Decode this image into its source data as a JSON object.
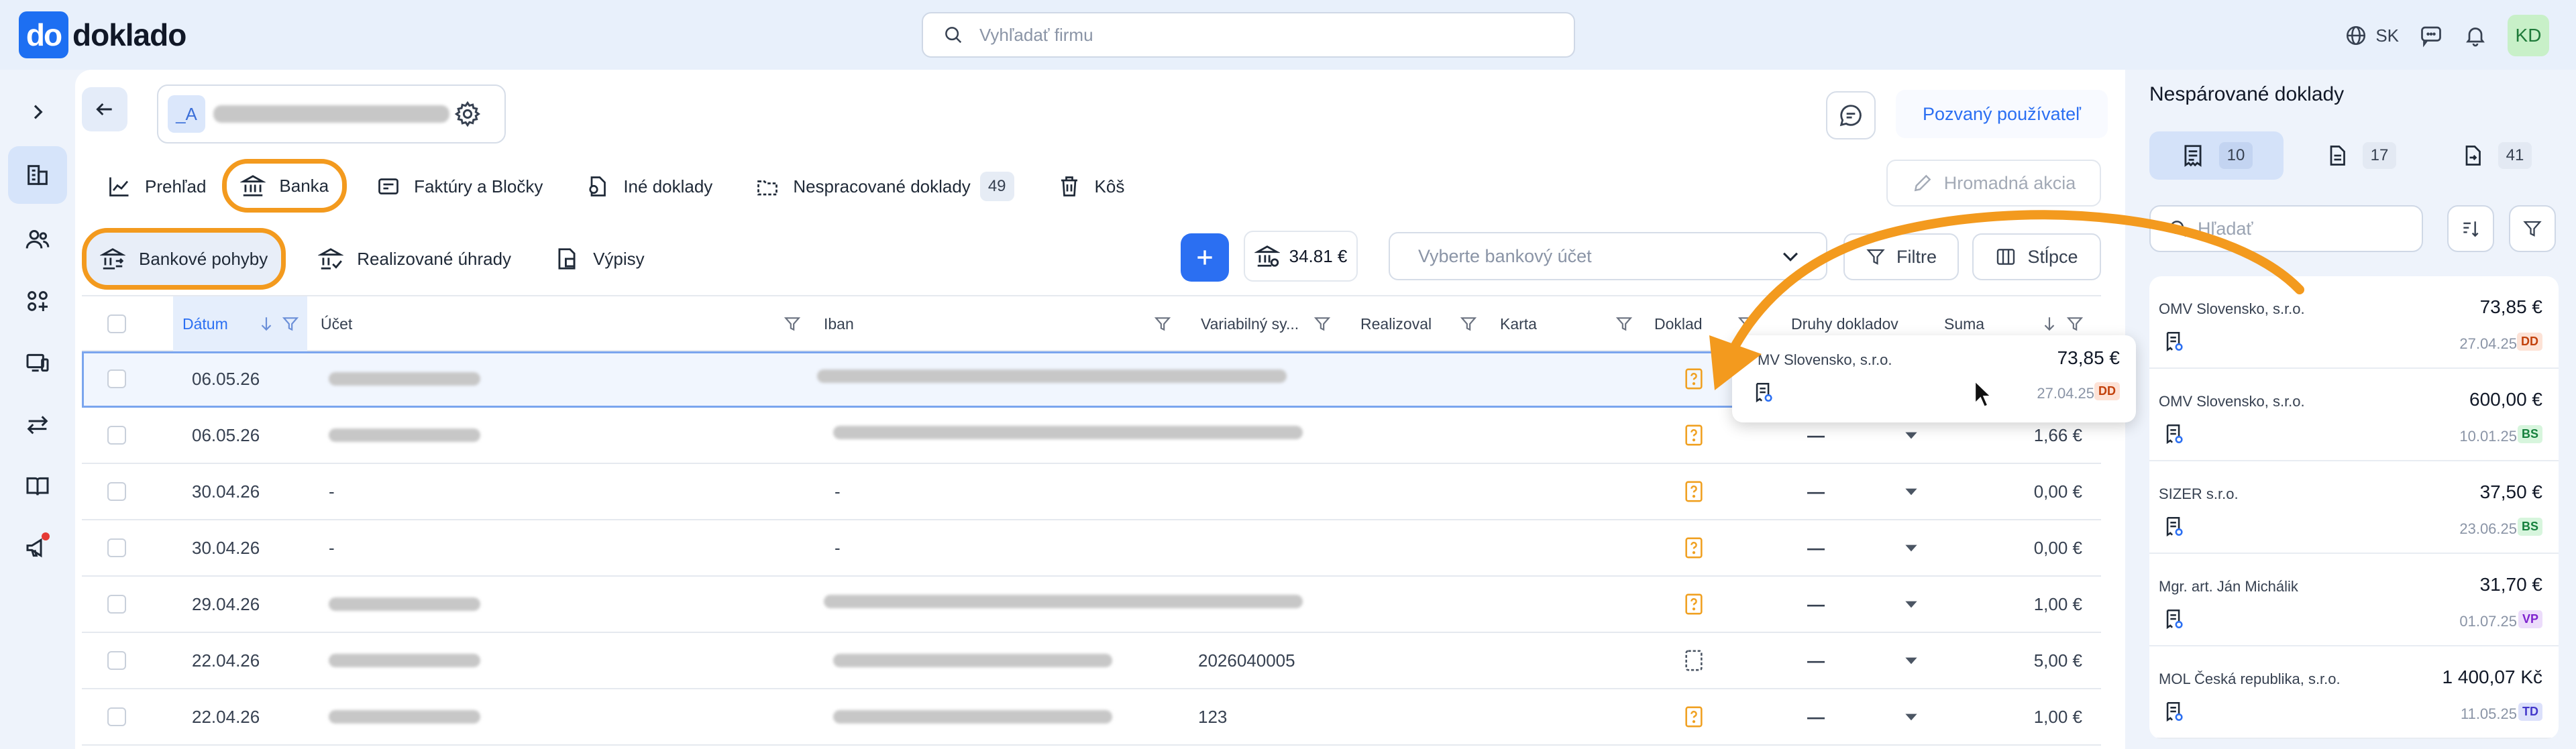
{
  "app": {
    "logo_mark": "do",
    "logo_text": "doklado"
  },
  "topbar": {
    "search_placeholder": "Vyhľadať firmu",
    "language": "SK",
    "avatar_initials": "KD"
  },
  "company": {
    "badge": "_A"
  },
  "main_tabs": [
    {
      "label": "Prehľad",
      "icon": "chart-line-icon"
    },
    {
      "label": "Banka",
      "icon": "bank-icon"
    },
    {
      "label": "Faktúry a Bločky",
      "icon": "invoice-icon"
    },
    {
      "label": "Iné doklady",
      "icon": "documents-icon"
    },
    {
      "label": "Nespracované doklady",
      "icon": "unprocessed-icon",
      "count": "49"
    },
    {
      "label": "Kôš",
      "icon": "trash-icon"
    }
  ],
  "sub_tabs": [
    {
      "label": "Bankové pohyby"
    },
    {
      "label": "Realizované úhrady"
    },
    {
      "label": "Výpisy"
    }
  ],
  "actions": {
    "invited_users": "Pozvaný používateľ",
    "bulk_action": "Hromadná akcia",
    "balance": "34.81 €",
    "account_placeholder": "Vyberte bankový účet",
    "filters": "Filtre",
    "columns": "Stĺpce"
  },
  "table": {
    "columns": {
      "date": "Dátum",
      "account": "Účet",
      "iban": "Iban",
      "vs": "Variabilný sy...",
      "realized": "Realizoval",
      "card": "Karta",
      "doc": "Doklad",
      "doc_types": "Druhy dokladov",
      "sum": "Suma"
    },
    "rows": [
      {
        "date": "06.05.26",
        "account": "",
        "vs": "",
        "doc_types": "",
        "sum": ""
      },
      {
        "date": "06.05.26",
        "account": "",
        "vs": "",
        "doc_types": "—",
        "sum": "1,66 €"
      },
      {
        "date": "30.04.26",
        "account": "-",
        "iban": "-",
        "vs": "",
        "doc_types": "—",
        "sum": "0,00 €"
      },
      {
        "date": "30.04.26",
        "account": "-",
        "iban": "-",
        "vs": "",
        "doc_types": "—",
        "sum": "0,00 €"
      },
      {
        "date": "29.04.26",
        "account": "",
        "vs": "",
        "doc_types": "—",
        "sum": "1,00 €"
      },
      {
        "date": "22.04.26",
        "account": "",
        "vs": "2026040005",
        "doc_types": "—",
        "sum": "5,00 €"
      },
      {
        "date": "22.04.26",
        "account": "",
        "vs": "123",
        "doc_types": "—",
        "sum": "1,00 €"
      }
    ]
  },
  "drag_preview": {
    "name": "MV Slovensko, s.r.o.",
    "amount": "73,85 €",
    "date": "27.04.25",
    "tag": "DD"
  },
  "right_panel": {
    "title": "Nespárované doklady",
    "segments": [
      {
        "count": "10",
        "icon": "receipt-icon"
      },
      {
        "count": "17",
        "icon": "document-icon"
      },
      {
        "count": "41",
        "icon": "export-document-icon"
      }
    ],
    "search_placeholder": "Hľadať",
    "cards": [
      {
        "name": "OMV Slovensko, s.r.o.",
        "amount": "73,85 €",
        "date": "27.04.25",
        "tag": "DD",
        "tag_bg": "#fde2d6",
        "tag_fg": "#c2410c"
      },
      {
        "name": "OMV Slovensko, s.r.o.",
        "amount": "600,00 €",
        "date": "10.01.25",
        "tag": "BS",
        "tag_bg": "#d7f5dd",
        "tag_fg": "#15803d"
      },
      {
        "name": "SIZER s.r.o.",
        "amount": "37,50 €",
        "date": "23.06.25",
        "tag": "BS",
        "tag_bg": "#d7f5dd",
        "tag_fg": "#15803d"
      },
      {
        "name": "Mgr. art. Ján Michálik",
        "amount": "31,70 €",
        "date": "01.07.25",
        "tag": "VP",
        "tag_bg": "#ecdcfb",
        "tag_fg": "#7e22ce"
      },
      {
        "name": "MOL Česká republika, s.r.o.",
        "amount": "1 400,07 Kč",
        "date": "11.05.25",
        "tag": "TD",
        "tag_bg": "#dbe0fb",
        "tag_fg": "#4338ca"
      }
    ]
  },
  "colors": {
    "accent": "#2b6ff2",
    "highlight": "#f39a1e",
    "doc_icon": "#f0a020"
  }
}
